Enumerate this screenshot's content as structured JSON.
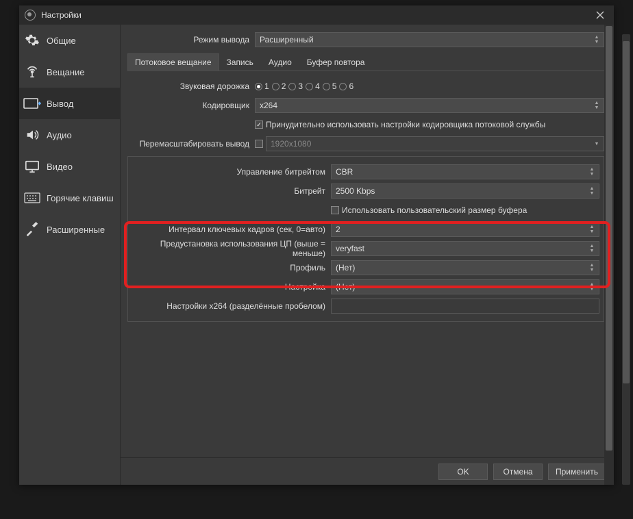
{
  "window": {
    "title": "Настройки"
  },
  "sidebar": {
    "items": [
      {
        "label": "Общие"
      },
      {
        "label": "Вещание"
      },
      {
        "label": "Вывод"
      },
      {
        "label": "Аудио"
      },
      {
        "label": "Видео"
      },
      {
        "label": "Горячие клавиш"
      },
      {
        "label": "Расширенные"
      }
    ]
  },
  "top": {
    "mode_label": "Режим вывода",
    "mode_value": "Расширенный"
  },
  "tabs": {
    "stream": "Потоковое вещание",
    "record": "Запись",
    "audio": "Аудио",
    "replay": "Буфер повтора"
  },
  "stream": {
    "track_label": "Звуковая дорожка",
    "tracks": [
      "1",
      "2",
      "3",
      "4",
      "5",
      "6"
    ],
    "encoder_label": "Кодировщик",
    "encoder_value": "x264",
    "enforce_label": "Принудительно использовать настройки кодировщика потоковой службы",
    "rescale_label": "Перемасштабировать вывод",
    "rescale_value": "1920x1080"
  },
  "encoder": {
    "rate_ctrl_label": "Управление битрейтом",
    "rate_ctrl_value": "CBR",
    "bitrate_label": "Битрейт",
    "bitrate_value": "2500 Kbps",
    "custom_buf_label": "Использовать пользовательский размер буфера",
    "keyint_label": "Интервал ключевых кадров (сек, 0=авто)",
    "keyint_value": "2",
    "preset_label": "Предустановка использования ЦП (выше = меньше)",
    "preset_value": "veryfast",
    "profile_label": "Профиль",
    "profile_value": "(Нет)",
    "tune_label": "Настройка",
    "tune_value": "(Нет)",
    "x264opts_label": "Настройки x264 (разделённые пробелом)"
  },
  "buttons": {
    "ok": "OK",
    "cancel": "Отмена",
    "apply": "Применить"
  }
}
